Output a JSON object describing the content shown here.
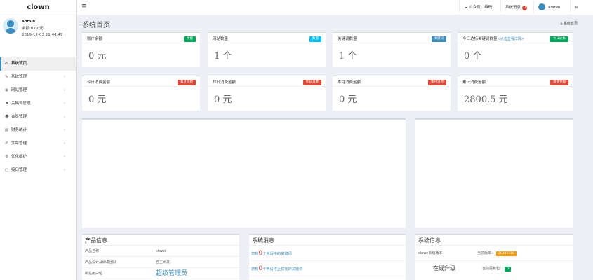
{
  "brand": "clown",
  "user": {
    "name": "admin",
    "balance": "余额:0.00元",
    "time": "2019-12-03 21:44:49"
  },
  "menu": [
    {
      "icon": "⌂",
      "label": "系统首页",
      "active": true
    },
    {
      "icon": "✎",
      "label": "系统管理"
    },
    {
      "icon": "◉",
      "label": "网站管理"
    },
    {
      "icon": "⚑",
      "label": "关键词管理"
    },
    {
      "icon": "☻",
      "label": "会员管理"
    },
    {
      "icon": "▤",
      "label": "财务统计"
    },
    {
      "icon": "✐",
      "label": "文章管理"
    },
    {
      "icon": "⚙",
      "label": "优化维护"
    },
    {
      "icon": "▢",
      "label": "接口管理"
    }
  ],
  "topbar": {
    "wechat": "公众号二维码",
    "sysmsg": "系统消息",
    "sysmsg_count": "0",
    "user": "admin"
  },
  "page": {
    "title": "系统首页",
    "crumb": "系统首页"
  },
  "stats": [
    {
      "label": "账户余额",
      "tag": "余额",
      "color": "#00a65a",
      "value": "0 元"
    },
    {
      "label": "网站数量",
      "tag": "数量",
      "color": "#00c0ef",
      "value": "1 个"
    },
    {
      "label": "关键词数量",
      "tag": "关键词",
      "color": "#3c8dbc",
      "value": "1 个"
    },
    {
      "label": "今日达标关键词数量",
      "link": "<点击查看详情>",
      "tag": "今日达标",
      "color": "#00a65a",
      "value": "0 个"
    },
    {
      "label": "今日消费金额",
      "tag": "累计消费",
      "color": "#dd4b39",
      "value": "0 元"
    },
    {
      "label": "昨日消费金额",
      "tag": "昨日消费",
      "color": "#dd4b39",
      "value": "0 元"
    },
    {
      "label": "本月消费金额",
      "tag": "本月消费",
      "color": "#dd4b39",
      "value": "0 元"
    },
    {
      "label": "累计消费金额",
      "tag": "消费金额",
      "color": "#dd4b39",
      "value": "2800.5 元"
    }
  ],
  "product": {
    "title": "产品信息",
    "rows": [
      {
        "k": "产品名称",
        "v": "clown"
      },
      {
        "k": "产品设计及研发团队",
        "v": "自主研发"
      },
      {
        "k": "所在用户组",
        "v": "超级管理员"
      }
    ]
  },
  "messages": {
    "title": "系统消息",
    "rows": [
      {
        "pre": "您有",
        "num": "0",
        "post": "个申请中的关键词"
      },
      {
        "pre": "您有",
        "num": "0",
        "post": "个申请停止优化的关键词"
      }
    ]
  },
  "sysinfo": {
    "title": "系统信息",
    "version_label": "clown系统版本",
    "current_label": "当前版本：",
    "version": "20191118",
    "status": "在线升级",
    "update_label": "当前更新包：",
    "update": "0",
    "version_color": "#f39c12",
    "update_color": "#00a65a"
  }
}
